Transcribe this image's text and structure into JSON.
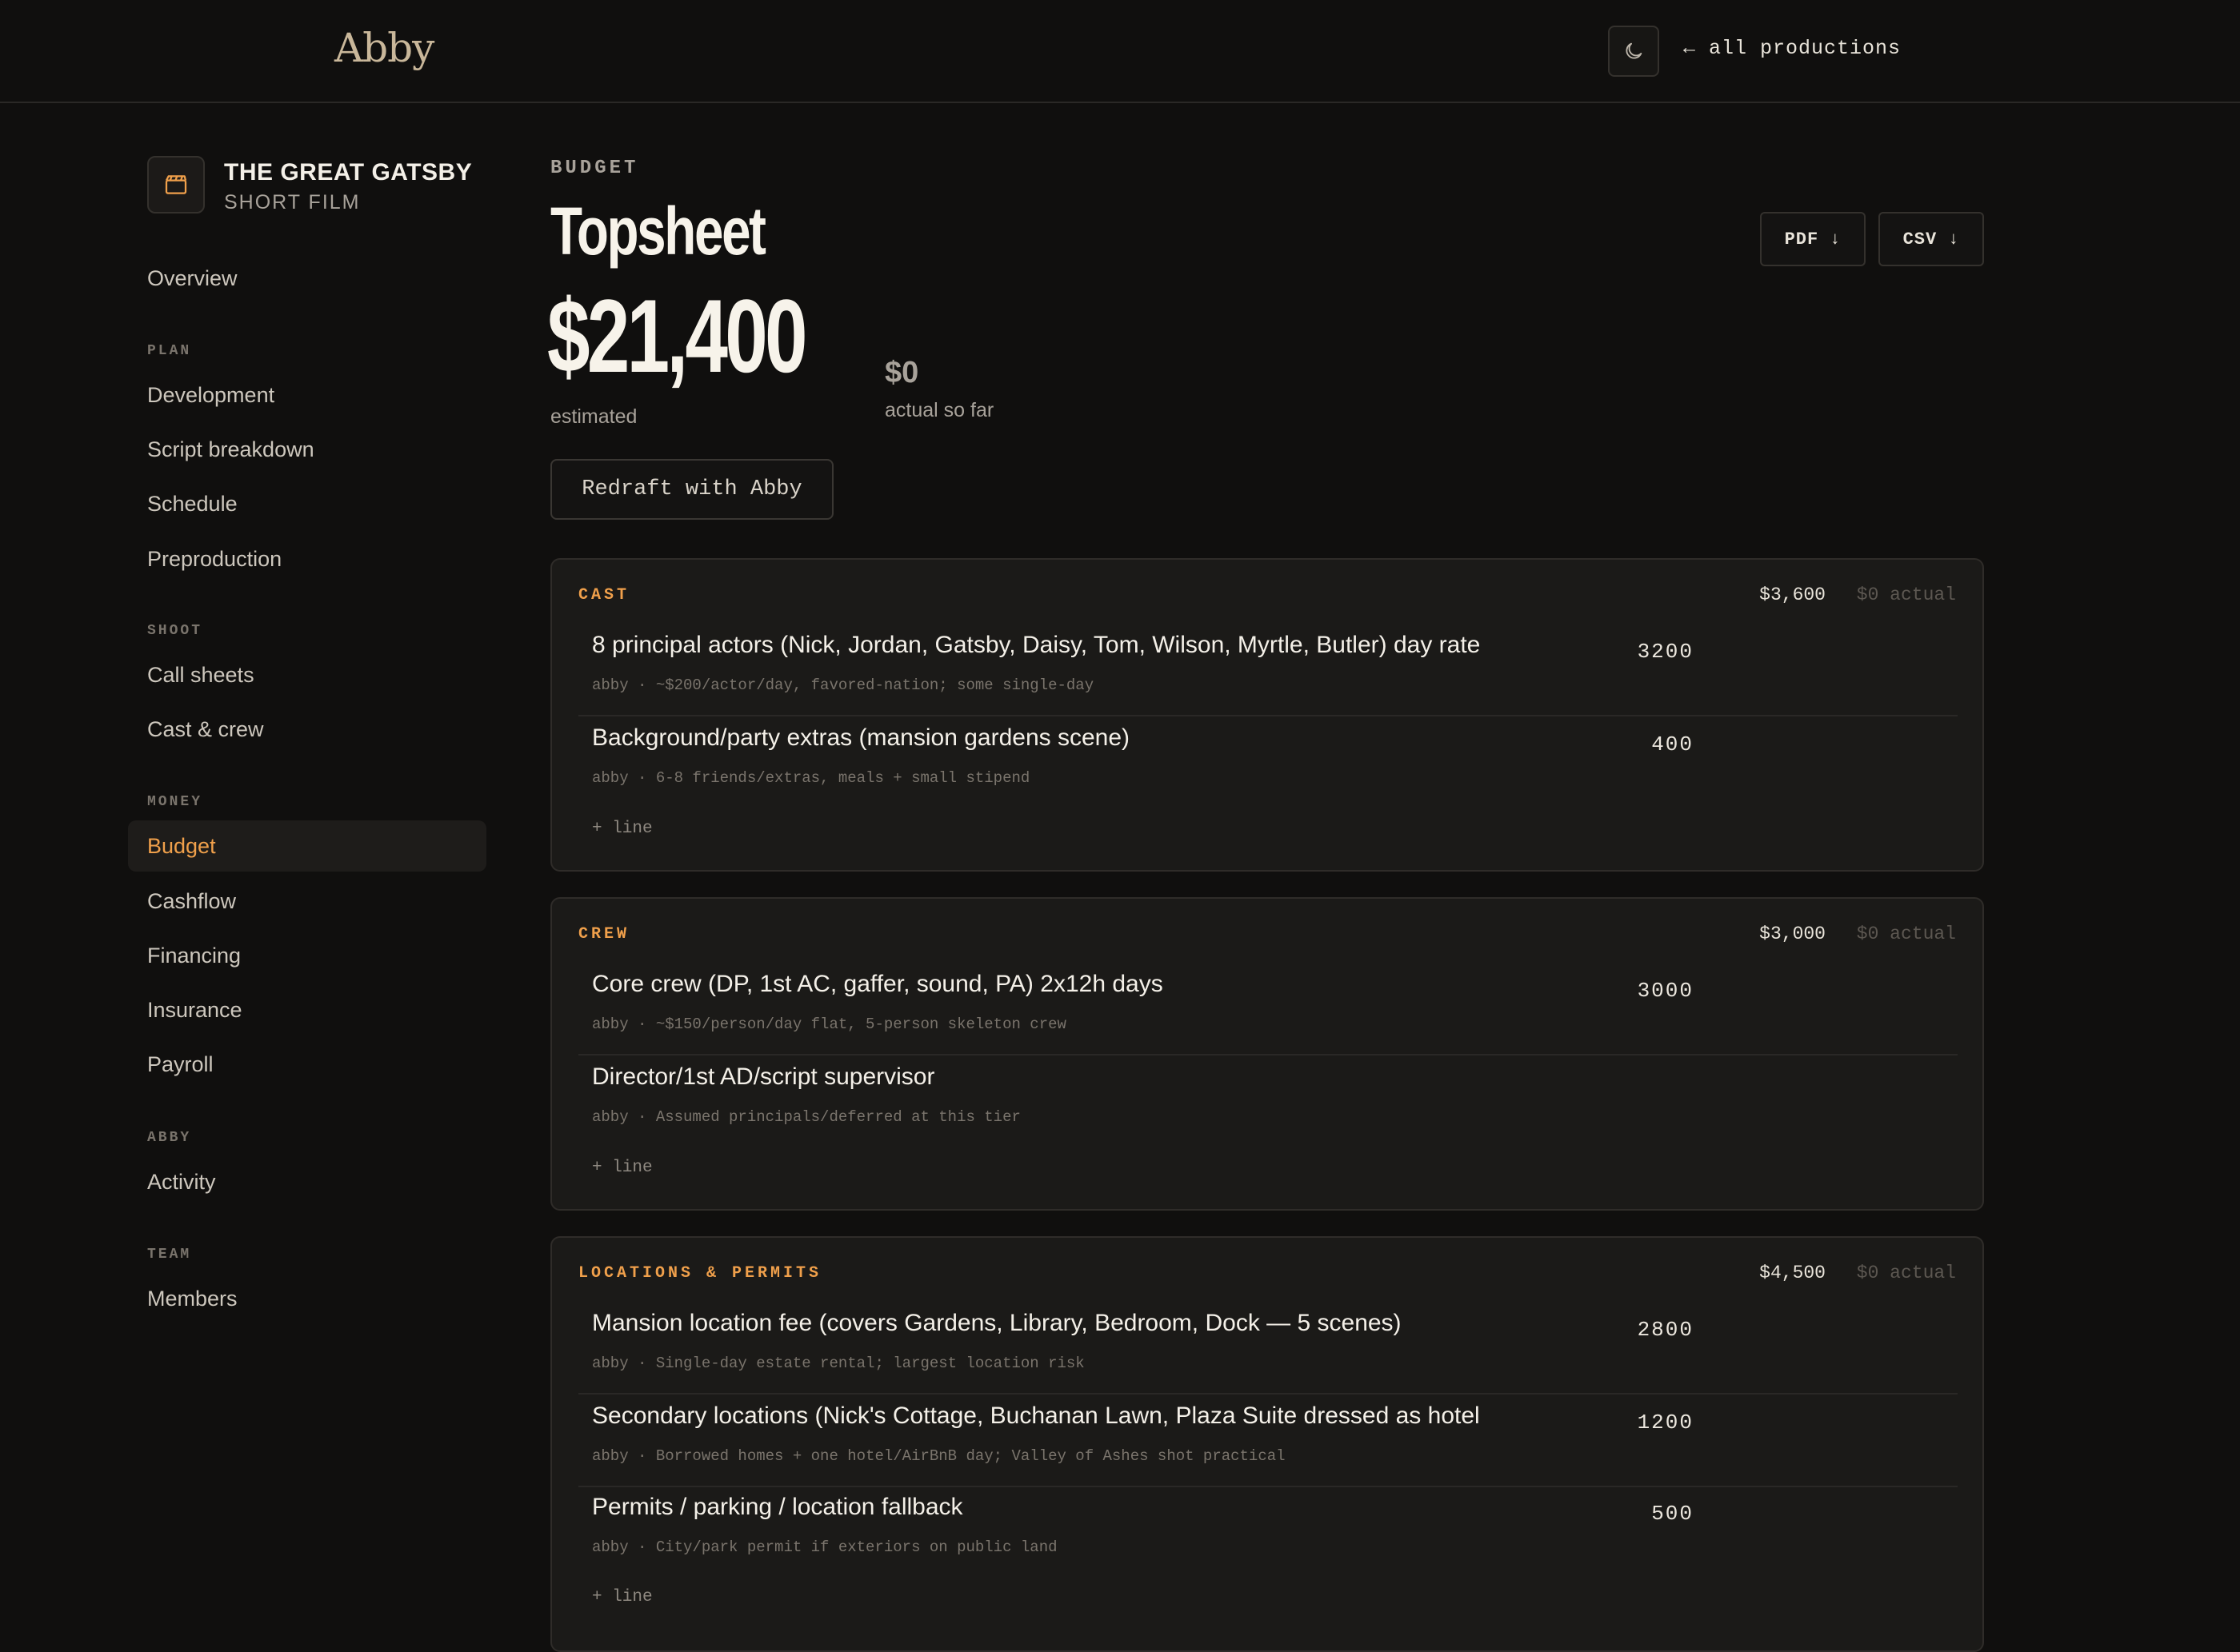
{
  "app": {
    "logo": "Abby",
    "all_productions": "← all productions"
  },
  "production": {
    "title": "THE GREAT GATSBY",
    "subtitle": "SHORT FILM"
  },
  "sidebar": {
    "overview": "Overview",
    "sections": [
      {
        "label": "PLAN",
        "items": [
          "Development",
          "Script breakdown",
          "Schedule",
          "Preproduction"
        ]
      },
      {
        "label": "SHOOT",
        "items": [
          "Call sheets",
          "Cast & crew"
        ]
      },
      {
        "label": "MONEY",
        "items": [
          "Budget",
          "Cashflow",
          "Financing",
          "Insurance",
          "Payroll"
        ]
      },
      {
        "label": "ABBY",
        "items": [
          "Activity"
        ]
      },
      {
        "label": "TEAM",
        "items": [
          "Members"
        ]
      }
    ],
    "active_item": "Budget"
  },
  "page": {
    "eyebrow": "BUDGET",
    "title": "Topsheet",
    "export_pdf": "PDF",
    "export_csv": "CSV",
    "export_arrow": "↓",
    "estimated_total": "$21,400",
    "estimated_label": "estimated",
    "actual_total": "$0",
    "actual_label": "actual so far",
    "redraft_label": "Redraft with Abby"
  },
  "add_line_label": "+ line",
  "budget_sections": [
    {
      "name": "CAST",
      "total": "$3,600",
      "actual": "$0 actual",
      "lines": [
        {
          "desc": "8 principal actors (Nick, Jordan, Gatsby, Daisy, Tom, Wilson, Myrtle, Butler) day rate",
          "note": "abby · ~$200/actor/day, favored-nation; some single-day",
          "amount": "3200"
        },
        {
          "desc": "Background/party extras (mansion gardens scene)",
          "note": "abby · 6-8 friends/extras, meals + small stipend",
          "amount": "400"
        }
      ]
    },
    {
      "name": "CREW",
      "total": "$3,000",
      "actual": "$0 actual",
      "lines": [
        {
          "desc": "Core crew (DP, 1st AC, gaffer, sound, PA) 2x12h days",
          "note": "abby · ~$150/person/day flat, 5-person skeleton crew",
          "amount": "3000"
        },
        {
          "desc": "Director/1st AD/script supervisor",
          "note": "abby · Assumed principals/deferred at this tier",
          "amount": ""
        }
      ]
    },
    {
      "name": "LOCATIONS & PERMITS",
      "total": "$4,500",
      "actual": "$0 actual",
      "lines": [
        {
          "desc": "Mansion location fee (covers Gardens, Library, Bedroom, Dock — 5 scenes)",
          "note": "abby · Single-day estate rental; largest location risk",
          "amount": "2800"
        },
        {
          "desc": "Secondary locations (Nick's Cottage, Buchanan Lawn, Plaza Suite dressed as hotel",
          "note": "abby · Borrowed homes + one hotel/AirBnB day; Valley of Ashes shot practical",
          "amount": "1200"
        },
        {
          "desc": "Permits / parking / location fallback",
          "note": "abby · City/park permit if exteriors on public land",
          "amount": "500"
        }
      ]
    }
  ],
  "colors": {
    "accent": "#f0a04b",
    "background": "#100f0e",
    "card": "#1b1a18"
  }
}
